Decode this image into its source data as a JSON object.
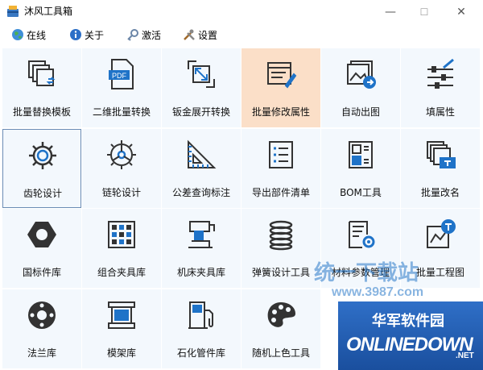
{
  "window": {
    "title": "沐风工具箱",
    "minimize": "—",
    "maximize": "☐",
    "close": "✕"
  },
  "menu": [
    {
      "label": "在线",
      "icon": "globe-icon"
    },
    {
      "label": "关于",
      "icon": "info-icon"
    },
    {
      "label": "激活",
      "icon": "key-icon"
    },
    {
      "label": "设置",
      "icon": "tools-icon"
    }
  ],
  "tools": [
    {
      "label": "批量替换模板",
      "icon": "replace-template-icon"
    },
    {
      "label": "二维批量转换",
      "icon": "pdf-icon"
    },
    {
      "label": "钣金展开转换",
      "icon": "unfold-icon"
    },
    {
      "label": "批量修改属性",
      "icon": "edit-properties-icon",
      "state": "hover"
    },
    {
      "label": "自动出图",
      "icon": "auto-drawing-icon"
    },
    {
      "label": "填属性",
      "icon": "fill-properties-icon"
    },
    {
      "label": "齿轮设计",
      "icon": "gear-icon",
      "state": "selected"
    },
    {
      "label": "链轮设计",
      "icon": "sprocket-icon"
    },
    {
      "label": "公差查询标注",
      "icon": "tolerance-icon"
    },
    {
      "label": "导出部件清单",
      "icon": "parts-list-icon"
    },
    {
      "label": "BOM工具",
      "icon": "bom-icon"
    },
    {
      "label": "批量改名",
      "icon": "rename-icon"
    },
    {
      "label": "国标件库",
      "icon": "nut-icon"
    },
    {
      "label": "组合夹具库",
      "icon": "fixture-grid-icon"
    },
    {
      "label": "机床夹具库",
      "icon": "machine-fixture-icon"
    },
    {
      "label": "弹簧设计工具",
      "icon": "spring-icon"
    },
    {
      "label": "材料参数管理",
      "icon": "material-icon"
    },
    {
      "label": "批量工程图",
      "icon": "batch-drawing-icon"
    },
    {
      "label": "法兰库",
      "icon": "flange-icon"
    },
    {
      "label": "模架库",
      "icon": "mold-base-icon"
    },
    {
      "label": "石化管件库",
      "icon": "pipe-fitting-icon"
    },
    {
      "label": "随机上色工具",
      "icon": "palette-icon"
    }
  ],
  "watermarks": {
    "top": "统一下载站",
    "url": "www.3987.com",
    "brand": "华军软件园",
    "brand_en": "ONLINEDOWN",
    "brand_suffix": ".NET"
  },
  "colors": {
    "accent": "#1f73c8",
    "hover": "#fbdfc8",
    "tile": "#f3f8fd"
  }
}
